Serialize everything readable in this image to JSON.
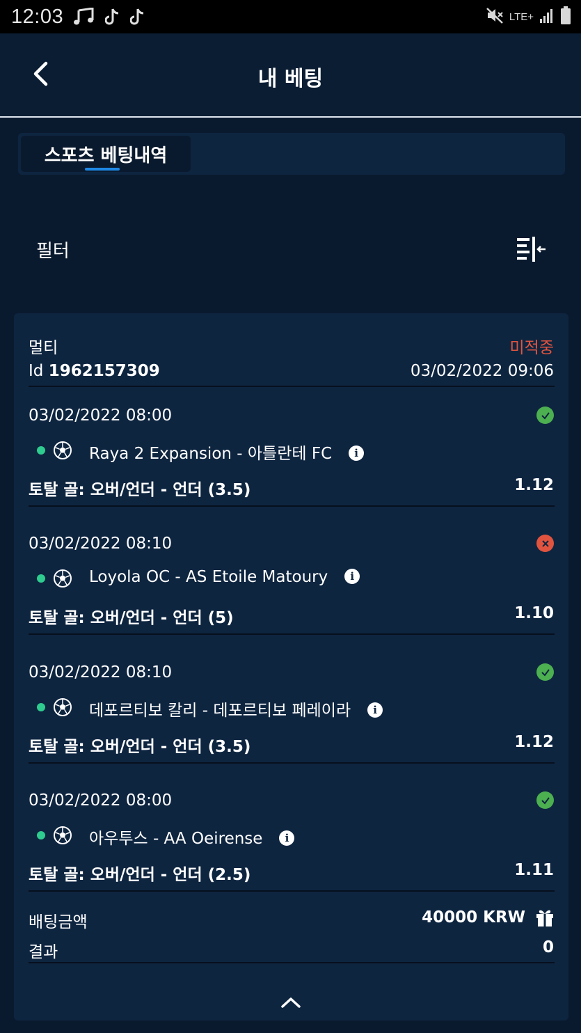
{
  "status_bar": {
    "time": "12:03",
    "network": "LTE+"
  },
  "header": {
    "title": "내 베팅"
  },
  "tabs": [
    {
      "label": "스포츠 베팅내역",
      "active": true
    }
  ],
  "filter": {
    "label": "필터"
  },
  "bet": {
    "type": "멀티",
    "status": "미적중",
    "id_prefix": "Id",
    "id": "1962157309",
    "placed_at": "03/02/2022 09:06",
    "legs": [
      {
        "date": "03/02/2022 08:00",
        "result": "won",
        "match": "Raya 2 Expansion - 아틀란테 FC",
        "market": "토탈 골: 오버/언더 - 언더 (3.5)",
        "odds": "1.12"
      },
      {
        "date": "03/02/2022 08:10",
        "result": "lost",
        "match": "Loyola OC - AS Etoile Matoury",
        "market": "토탈 골: 오버/언더 - 언더 (5)",
        "odds": "1.10"
      },
      {
        "date": "03/02/2022 08:10",
        "result": "won",
        "match": "데포르티보 칼리 - 데포르티보 페레이라",
        "market": "토탈 골: 오버/언더 - 언더 (3.5)",
        "odds": "1.12"
      },
      {
        "date": "03/02/2022 08:00",
        "result": "won",
        "match": "아우투스 - AA Oeirense",
        "market": "토탈 골: 오버/언더 - 언더 (2.5)",
        "odds": "1.11"
      }
    ],
    "stake_label": "배팅금액",
    "stake_value": "40000 KRW",
    "result_label": "결과",
    "result_value": "0"
  },
  "colors": {
    "background": "#0a1a2e",
    "card": "#0e2540",
    "lost_red": "#e0543f",
    "won_green": "#4caf50",
    "live_dot": "#2ecc8f",
    "tab_accent": "#1e88e5"
  },
  "icons": [
    "back-arrow-icon",
    "filter-icon",
    "soccer-ball-icon",
    "info-icon",
    "check-icon",
    "cross-icon",
    "gift-icon",
    "chevron-up-icon",
    "music-note-icon",
    "tiktok-icon",
    "mute-icon",
    "signal-icon",
    "battery-icon"
  ]
}
